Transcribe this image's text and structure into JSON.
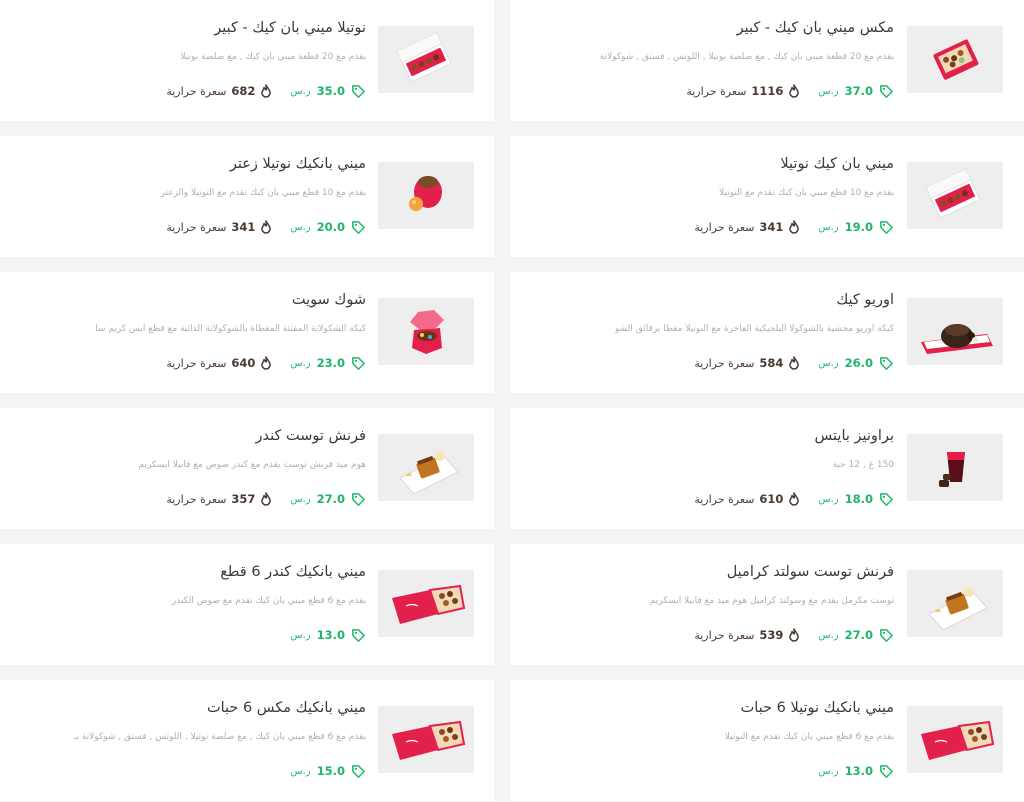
{
  "currency": "ر.س",
  "calorie_label": "سعرة حرارية",
  "colors": {
    "price": "#1fb56a",
    "box": "#e3204c",
    "thumb_bg": "#eeeeef"
  },
  "items": [
    {
      "title": "مكس ميني بان كيك - كبير",
      "desc": "يقدم مع 20 قطعة ميني بان كيك , مع صلصة نوتيلا , اللوتس , فستق , شوكولاتة",
      "price": "37.0",
      "kcal": "1116",
      "image": "pink-box-icon"
    },
    {
      "title": "نوتيلا ميني بان كيك - كبير",
      "desc": "يقدم مع 20 قطعة ميني بان كيك , مع صلصة نوتيلا",
      "price": "35.0",
      "kcal": "682",
      "image": "white-box-icon"
    },
    {
      "title": "ميني بان كيك نوتيلا",
      "desc": "يقدم مع 10 قطع ميني بان كيك تقدم مع النوتيلا",
      "price": "19.0",
      "kcal": "341",
      "image": "white-box-icon"
    },
    {
      "title": "ميني بانكيك نوتيلا زعتر",
      "desc": "يقدم مع 10 قطع ميني بان كيك تقدم مع النوتيلا والزعتر",
      "price": "20.0",
      "kcal": "341",
      "image": "cup-icon"
    },
    {
      "title": "اوريو كيك",
      "desc": "كيكة اوريو محشية بالشوكولا البلجيكية الفاخرة مع النوتيلا مغطا برقائق الشو",
      "price": "26.0",
      "kcal": "584",
      "image": "cake-tray-icon"
    },
    {
      "title": "شوك سويت",
      "desc": "كيكة الشكولاتة المفتتة المغطاة بالشوكولاتة الذائبة مع قطع ايس كريم سا",
      "price": "23.0",
      "kcal": "640",
      "image": "hexbox-icon"
    },
    {
      "title": "براونيز بايتس",
      "desc": "150 غ , 12 حبة",
      "price": "18.0",
      "kcal": "610",
      "image": "brownie-cup-icon"
    },
    {
      "title": "فرنش توست كندر",
      "desc": "هوم ميد فرنش توست يقدم مع كندر صوص مع فانيلا ايسكريم",
      "price": "27.0",
      "kcal": "357",
      "image": "toast-icon"
    },
    {
      "title": "فرنش توست سولتد كراميل",
      "desc": "توست مكرمل يقدم مع وسولتد كراميل هوم ميد مع فانيلا ايسكريم",
      "price": "27.0",
      "kcal": "539",
      "image": "toast-icon"
    },
    {
      "title": "ميني بانكيك كندر 6 قطع",
      "desc": "يقدم مع 6 قطع ميني بان كيك تقدم مع صوص الكندر",
      "price": "13.0",
      "kcal": "",
      "image": "pink-open-box-icon"
    },
    {
      "title": "ميني بانكيك نوتيلا 6 حبات",
      "desc": "يقدم مع 6 قطع ميني بان كيك تقدم مع النوتيلا",
      "price": "13.0",
      "kcal": "",
      "image": "pink-open-box-icon"
    },
    {
      "title": "ميني بانكيك مكس 6 حبات",
      "desc": "يقدم مع 6 قطع ميني بان كيك , مع صلصة نوتيلا , اللوتس , فستق , شوكولاتة بـ",
      "price": "15.0",
      "kcal": "",
      "image": "pink-open-box-icon"
    }
  ]
}
